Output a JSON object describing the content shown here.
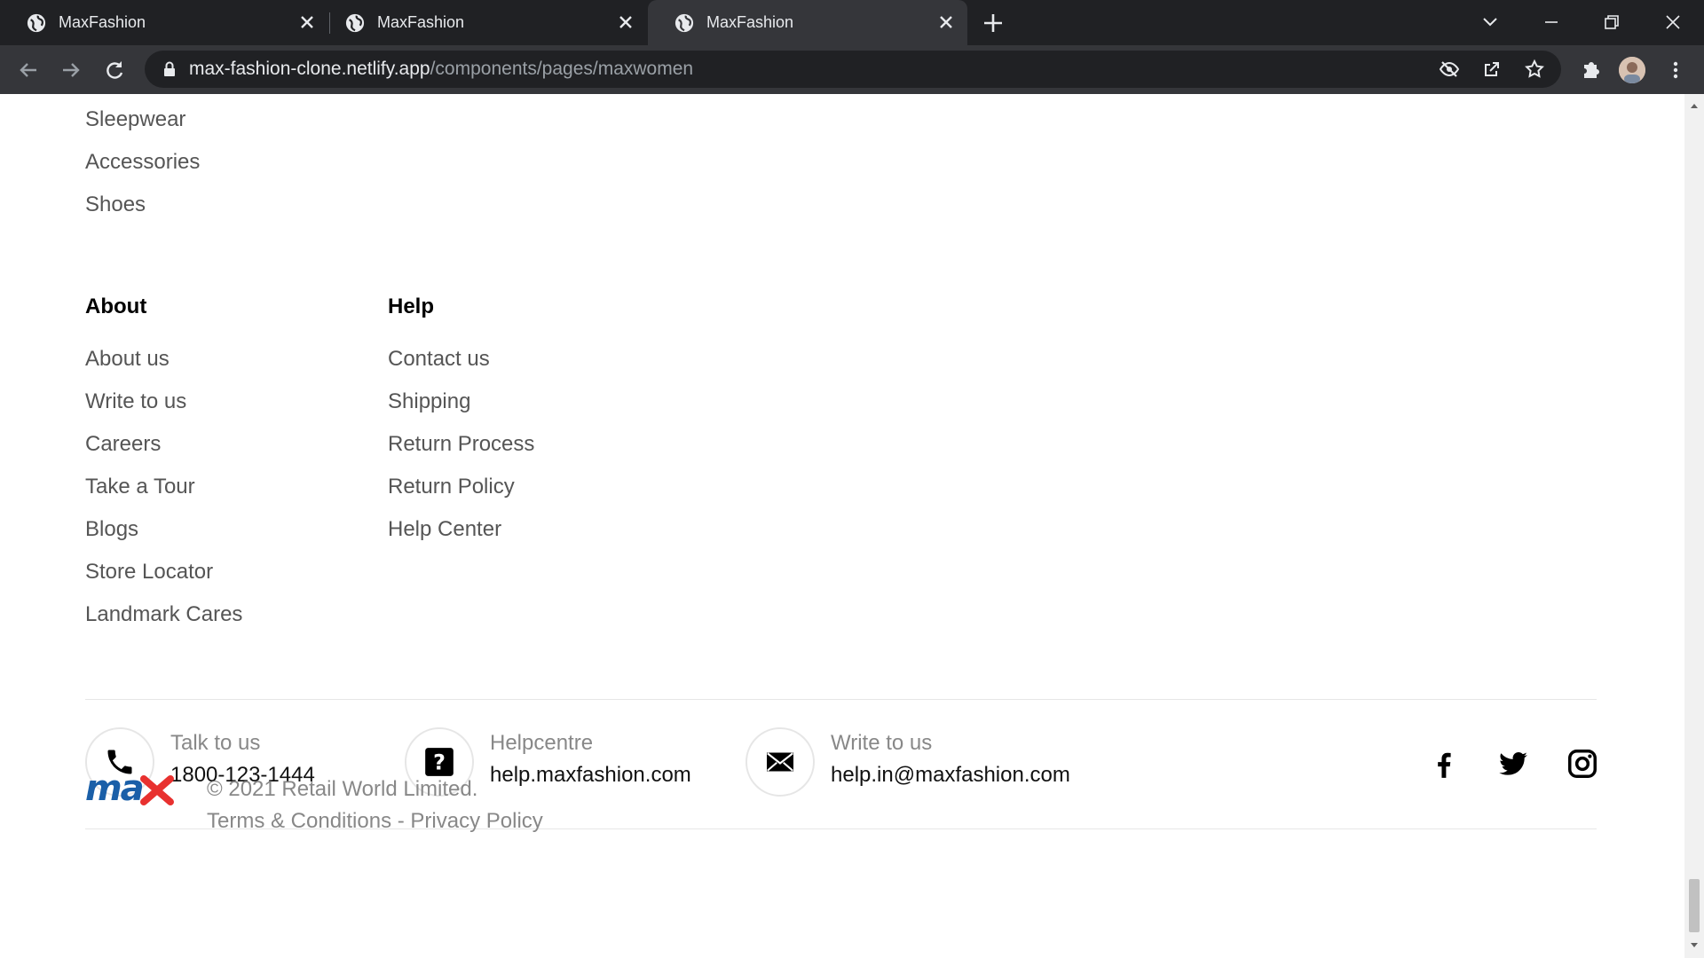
{
  "browser": {
    "tabs": [
      {
        "title": "MaxFashion"
      },
      {
        "title": "MaxFashion"
      },
      {
        "title": "MaxFashion"
      }
    ],
    "url_host": "max-fashion-clone.netlify.app",
    "url_path": "/components/pages/maxwomen"
  },
  "footer": {
    "top_links": [
      "Sleepwear",
      "Accessories",
      "Shoes"
    ],
    "about": {
      "heading": "About",
      "links": [
        "About us",
        "Write to us",
        "Careers",
        "Take a Tour",
        "Blogs",
        "Store Locator",
        "Landmark Cares"
      ]
    },
    "help": {
      "heading": "Help",
      "links": [
        "Contact us",
        "Shipping",
        "Return Process",
        "Return Policy",
        "Help Center"
      ]
    },
    "contacts": [
      {
        "label": "Talk to us",
        "value": "1800-123-1444",
        "icon": "phone-icon"
      },
      {
        "label": "Helpcentre",
        "value": "help.maxfashion.com",
        "icon": "question-icon"
      },
      {
        "label": "Write to us",
        "value": "help.in@maxfashion.com",
        "icon": "mail-icon"
      }
    ],
    "social": [
      "facebook-icon",
      "twitter-icon",
      "instagram-icon"
    ],
    "logo_text": "max",
    "copyright": "© 2021 Retail World Limited.",
    "legal": "Terms & Conditions - Privacy Policy"
  }
}
